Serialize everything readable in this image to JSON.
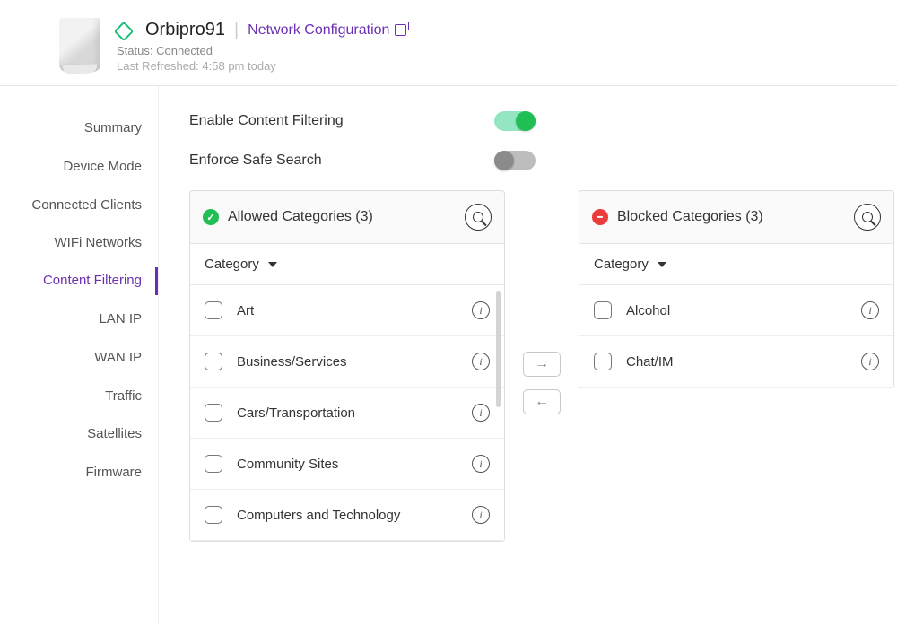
{
  "header": {
    "device_name": "Orbipro91",
    "config_link": "Network Configuration",
    "status_label": "Status:",
    "status_value": "Connected",
    "refreshed_label": "Last Refreshed:",
    "refreshed_value": "4:58 pm today"
  },
  "sidebar": {
    "items": [
      {
        "id": "summary",
        "label": "Summary"
      },
      {
        "id": "device-mode",
        "label": "Device Mode"
      },
      {
        "id": "connected-clients",
        "label": "Connected Clients"
      },
      {
        "id": "wifi-networks",
        "label": "WIFi Networks"
      },
      {
        "id": "content-filtering",
        "label": "Content Filtering",
        "active": true
      },
      {
        "id": "lan-ip",
        "label": "LAN IP"
      },
      {
        "id": "wan-ip",
        "label": "WAN IP"
      },
      {
        "id": "traffic",
        "label": "Traffic"
      },
      {
        "id": "satellites",
        "label": "Satellites"
      },
      {
        "id": "firmware",
        "label": "Firmware"
      }
    ]
  },
  "settings": {
    "enable_cf_label": "Enable Content Filtering",
    "enable_cf_on": true,
    "safe_search_label": "Enforce Safe Search",
    "safe_search_on": false
  },
  "allowed_panel": {
    "title": "Allowed Categories (3)",
    "column_header": "Category",
    "items": [
      {
        "label": "Art"
      },
      {
        "label": "Business/Services"
      },
      {
        "label": "Cars/Transportation"
      },
      {
        "label": "Community Sites"
      },
      {
        "label": "Computers and Technology"
      }
    ]
  },
  "blocked_panel": {
    "title": "Blocked Categories (3)",
    "column_header": "Category",
    "items": [
      {
        "label": "Alcohol"
      },
      {
        "label": "Chat/IM"
      }
    ]
  },
  "transfer": {
    "move_right": "→",
    "move_left": "←"
  },
  "icons": {
    "check": "✓",
    "minus": "━",
    "info": "i"
  }
}
